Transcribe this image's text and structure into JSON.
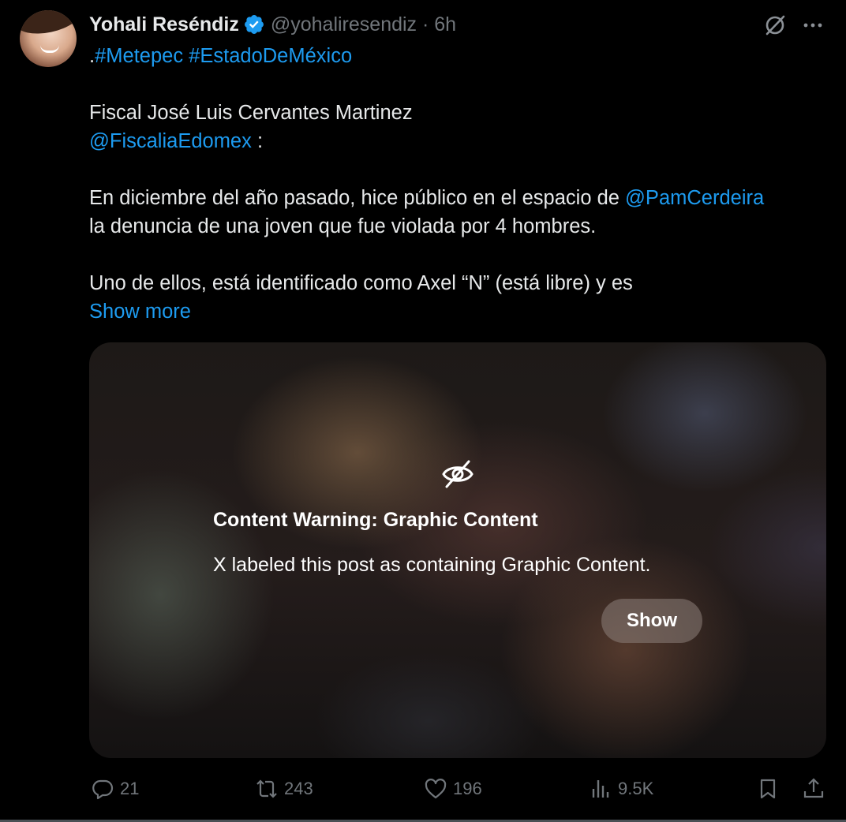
{
  "author": {
    "display_name": "Yohali Reséndiz",
    "handle_time": "@yohaliresendiz · 6h",
    "verified_color": "#1d9bf0"
  },
  "post": {
    "line1_prefix": ".",
    "hashtag1": "#Metepec",
    "hashtag2": "#EstadoDeMéxico",
    "line2": "Fiscal José Luis Cervantes Martinez",
    "mention1": "@FiscaliaEdomex",
    "mention1_suffix": " :",
    "line4_prefix": "En diciembre del año pasado, hice público en el espacio de ",
    "mention2": "@PamCerdeira",
    "line5": "la denuncia de una joven que fue violada por 4 hombres.",
    "line6": "Uno de ellos, está identificado como Axel “N” (está libre) y es",
    "show_more": "Show more"
  },
  "media_warning": {
    "title": "Content Warning: Graphic Content",
    "description": "X labeled this post as containing Graphic Content.",
    "show_button": "Show"
  },
  "actions": {
    "replies": "21",
    "reposts": "243",
    "likes": "196",
    "views": "9.5K"
  },
  "icons": [
    "verified-icon",
    "grok-icon",
    "more-icon",
    "eye-off-icon",
    "reply-icon",
    "repost-icon",
    "like-icon",
    "views-icon",
    "bookmark-icon",
    "share-icon"
  ],
  "colors": {
    "background": "#000000",
    "text": "#e7e9ea",
    "secondary": "#71767b",
    "link": "#1d9bf0"
  }
}
